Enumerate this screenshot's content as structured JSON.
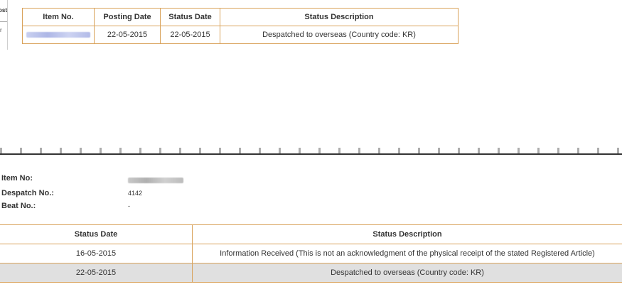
{
  "top_panel": {
    "left_stub_text": "ost",
    "left_stub_mark": "r",
    "table": {
      "headers": [
        "Item No.",
        "Posting Date",
        "Status Date",
        "Status Description"
      ],
      "rows": [
        {
          "item_no": "",
          "posting_date": "22-05-2015",
          "status_date": "22-05-2015",
          "status_description": "Despatched to overseas (Country code: KR)"
        }
      ]
    }
  },
  "details": {
    "item_no_label": "Item No:",
    "despatch_no_label": "Despatch No.:",
    "despatch_no_value": "4142",
    "beat_no_label": "Beat No.:",
    "beat_no_value": "-"
  },
  "status_table": {
    "headers": [
      "Status Date",
      "Status Description"
    ],
    "rows": [
      {
        "status_date": "16-05-2015",
        "status_description": "Information Received (This is not an acknowledgment of the physical receipt of the stated Registered Article)"
      },
      {
        "status_date": "22-05-2015",
        "status_description": "Despatched to overseas (Country code: KR)"
      }
    ]
  }
}
